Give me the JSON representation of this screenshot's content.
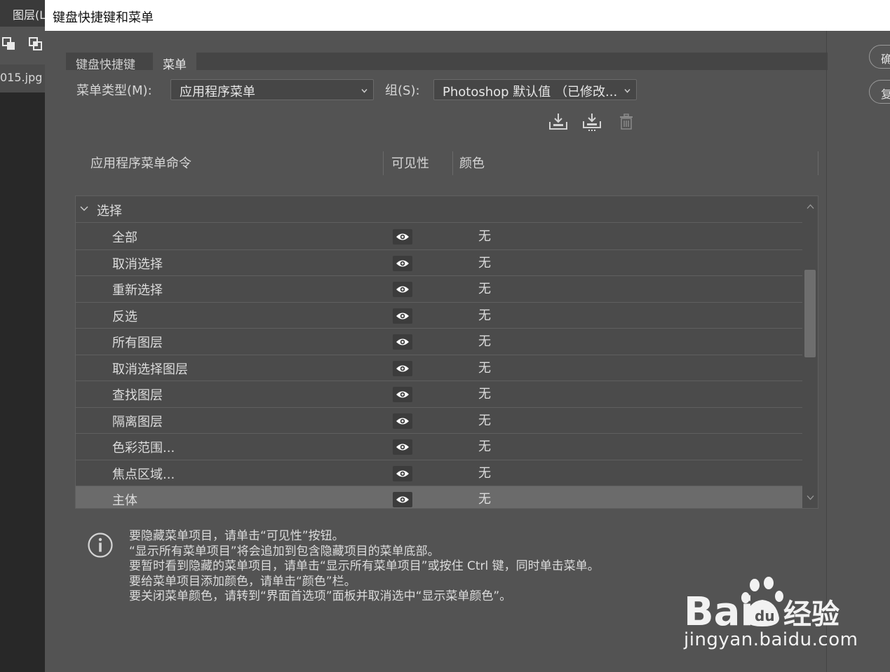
{
  "app": {
    "layers_tab": "图层(L",
    "file_tab": "015.jpg (",
    "right_buttons": [
      "确",
      "复"
    ]
  },
  "dialog": {
    "title": "键盘快捷键和菜单",
    "tabs": [
      {
        "label": "键盘快捷键",
        "active": false
      },
      {
        "label": "菜单",
        "active": true
      }
    ],
    "menu_type_label": "菜单类型(M):",
    "menu_type_value": "应用程序菜单",
    "group_label": "组(S):",
    "group_value": "Photoshop 默认值 （已修改...",
    "columns": {
      "command": "应用程序菜单命令",
      "visibility": "可见性",
      "color": "颜色"
    },
    "group_name": "选择",
    "rows": [
      {
        "label": "全部",
        "color": "无",
        "selected": false
      },
      {
        "label": "取消选择",
        "color": "无",
        "selected": false
      },
      {
        "label": "重新选择",
        "color": "无",
        "selected": false
      },
      {
        "label": "反选",
        "color": "无",
        "selected": false
      },
      {
        "label": "所有图层",
        "color": "无",
        "selected": false
      },
      {
        "label": "取消选择图层",
        "color": "无",
        "selected": false
      },
      {
        "label": "查找图层",
        "color": "无",
        "selected": false
      },
      {
        "label": "隔离图层",
        "color": "无",
        "selected": false
      },
      {
        "label": "色彩范围...",
        "color": "无",
        "selected": false
      },
      {
        "label": "焦点区域...",
        "color": "无",
        "selected": false
      },
      {
        "label": "主体",
        "color": "无",
        "selected": true
      }
    ],
    "scroll_position": 0.3,
    "info_lines": [
      "要隐藏菜单项目，请单击“可见性”按钮。",
      "“显示所有菜单项目”将会追加到包含隐藏项目的菜单底部。",
      "要暂时看到隐藏的菜单项目，请单击“显示所有菜单项目”或按住 Ctrl 键，同时单击菜单。",
      "要给菜单项目添加颜色，请单击“颜色”栏。",
      "要关闭菜单颜色，请转到“界面首选项”面板并取消选中“显示菜单颜色”。"
    ]
  },
  "watermark": {
    "brand_left": "Bai",
    "brand_right": "经验",
    "url": "jingyan.baidu.com"
  },
  "icons": {
    "save_set": "save-set-icon",
    "save_set_as": "save-set-as-icon",
    "delete": "trash-icon",
    "visibility": "eye-icon",
    "info": "info-icon"
  },
  "colors": {
    "dialog_bg": "#535353",
    "table_bg": "#4b4b4b",
    "selected_row": "#6b6b6b",
    "titlebar": "#ffffff"
  }
}
